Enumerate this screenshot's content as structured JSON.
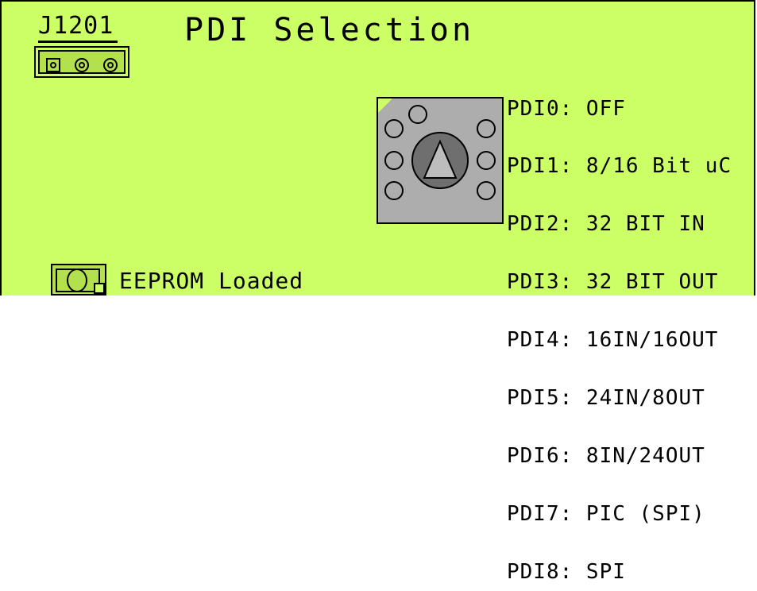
{
  "board": {
    "background": "#ccff66",
    "connector_label": "J1201",
    "title": "PDI Selection"
  },
  "pdi_options": [
    "PDI0: OFF",
    "PDI1: 8/16 Bit uC",
    "PDI2: 32 BIT IN",
    "PDI3: 32 BIT OUT",
    "PDI4: 16IN/16OUT",
    "PDI5: 24IN/8OUT",
    "PDI6: 8IN/24OUT",
    "PDI7: PIC (SPI)",
    "PDI8: SPI"
  ],
  "led": {
    "label": "EEPROM Loaded"
  },
  "switch": {
    "icon": "rotary-switch-icon",
    "color": "#adadad"
  }
}
